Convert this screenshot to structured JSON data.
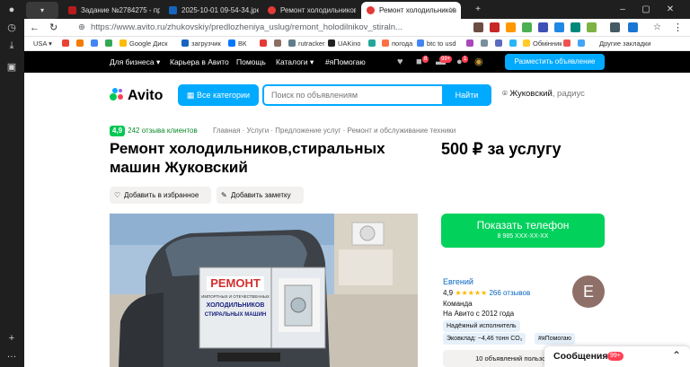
{
  "browser": {
    "tabs": [
      {
        "label": "Задание №2784275 - про",
        "color": "#b71c1c"
      },
      {
        "label": "2025-10-01 09-54-34.jpeg",
        "color": "#1565c0"
      },
      {
        "label": "Ремонт холодильников в",
        "color": "#e53935"
      },
      {
        "label": "Ремонт холодильников",
        "color": "#e53935"
      }
    ],
    "url": "https://www.avito.ru/zhukovskiy/predlozheniya_uslug/remont_holodilnikov_stiraln...",
    "bookmarks": [
      "USA",
      "Google Диск",
      "загрузчик",
      "ВК",
      "rutracker",
      "UAKino",
      "погода",
      "btc to usd",
      "Обмінник",
      "Другие закладки"
    ]
  },
  "avito_top": {
    "links": [
      "Для бизнеса",
      "Карьера в Авито",
      "Помощь",
      "Каталоги",
      "#яПомогаю"
    ],
    "badges": [
      "8",
      "99+",
      "1"
    ],
    "post_button": "Разместить объявление"
  },
  "header": {
    "logo": "Avito",
    "categories_button": "Все категории",
    "search_placeholder": "Поиск по объявлениям",
    "find_button": "Найти",
    "city": "Жуковский",
    "city_suffix": ", радиус"
  },
  "listing": {
    "rating_value": "4,9",
    "reviews_link": "242 отзыва клиентов",
    "breadcrumbs": "Главная · Услуги · Предложение услуг · Ремонт и обслуживание техники",
    "title": "Ремонт холодильников,стиральных машин Жуковский",
    "price": "500 ₽ за услугу",
    "favorite_button": "Добавить в избранное",
    "note_button": "Добавить заметку",
    "photo": {
      "banner_word": "РЕМОНТ",
      "banner_small": "ИМПОРТНЫХ И ОТЕЧЕСТВЕННЫХ",
      "banner_line": "ХОЛОДИЛЬНИКОВ",
      "banner_line2": "СТИРАЛЬНЫХ МАШИН"
    }
  },
  "contact": {
    "call_button": "Показать телефон",
    "phone": "8 985 XXX-XX-XX"
  },
  "seller": {
    "name": "Евгений",
    "rating": "4,9",
    "stars": "★★★★★",
    "reviews": "266 отзывов",
    "type": "Команда",
    "since": "На Авито с 2012 года",
    "avatar_letter": "Е",
    "badges": [
      "Надёжный исполнитель",
      "Эковклад: ~4,46 тонн CO₂",
      "#яПомогаю"
    ],
    "more_ads": "10 объявлений пользователя"
  },
  "messenger": {
    "label": "Сообщения",
    "count": "99+"
  }
}
